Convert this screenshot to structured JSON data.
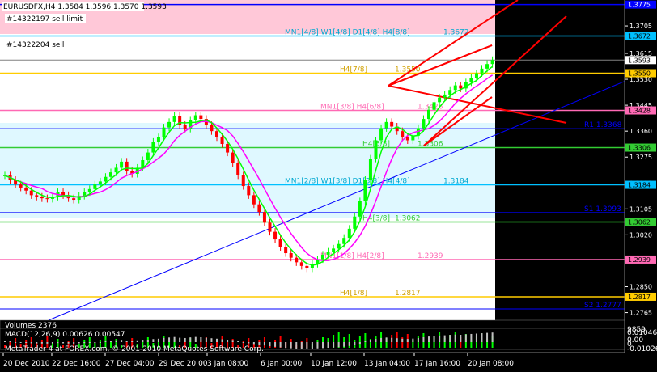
{
  "header": {
    "title": "EURUSDFX,H4  1.3584 1.3596 1.3570 1.3593"
  },
  "orders": {
    "sell_limit": "#14322197 sell limit",
    "sell": "#14322204 sell"
  },
  "price_axis": {
    "ticks": [
      "1.3705",
      "1.3615",
      "1.3530",
      "1.3445",
      "1.3360",
      "1.3275",
      "1.3190",
      "1.3105",
      "1.3020",
      "1.2935",
      "1.2850",
      "1.2765"
    ]
  },
  "price_tags": {
    "top_blue": "1.3775",
    "cyan1": "1.3672",
    "current": "1.3593",
    "yellow": "1.3550",
    "pink1": "1.3428",
    "green1": "1.3306",
    "cyan2": "1.3184",
    "green2": "1.3062",
    "pink2": "1.2939",
    "yellow2": "1.2817"
  },
  "murrey_labels": {
    "mn1_4": "MN1[4/8] W1[4/8] D1[4/8] H4[8/8]",
    "v_3672": "1.3672",
    "h4_78": "H4[7/8]",
    "v_3550": "1.3550",
    "mn1_38": "MN1[3/8] H4[6/8]",
    "v_3428": "1.3428",
    "r1_3368": "R1 1.3368",
    "h4_58": "H4[5/8]",
    "v_3306": "1.3306",
    "mn1_28": "MN1[2/8] W1[3/8] D1[3/8] H4[4/8]",
    "v_3184": "1.3184",
    "s1_3093": "S1 1.3093",
    "h4_38": "H4[3/8]",
    "v_3062": "1.3062",
    "mn1_18": "MN1[1/8] H4[2/8]",
    "v_2939": "1.2939",
    "h4_18": "H4[1/8]",
    "v_2817": "1.2817",
    "s2_2777": "S2 1.2777"
  },
  "volumes": {
    "label": "Volumes 2376",
    "scale_top": "9859",
    "scale_bottom": "0"
  },
  "macd": {
    "label": "MACD(12,26,9) 0.00626 0.00547",
    "scale_top": "0.01046",
    "scale_mid": "0.00",
    "scale_bottom": "-0.01026"
  },
  "time_axis": {
    "ticks": [
      "20 Dec 2010",
      "22 Dec 16:00",
      "27 Dec 04:00",
      "29 Dec 20:00",
      "3 Jan 08:00",
      "6 Jan 00:00",
      "10 Jan 12:00",
      "13 Jan 04:00",
      "17 Jan 16:00",
      "20 Jan 08:00"
    ]
  },
  "footer": {
    "copyright": "MetaTrader 4 at FOREX.com, © 2001-2010 MetaQuotes Software Corp."
  },
  "colors": {
    "background": "#000000",
    "bull_candle": "#00ff00",
    "bear_candle": "#ff0000",
    "ma_fast": "#00ff00",
    "ma_slow": "#ff00ff",
    "pitchfork": "#ff0000",
    "trendline": "#0000ff"
  }
}
